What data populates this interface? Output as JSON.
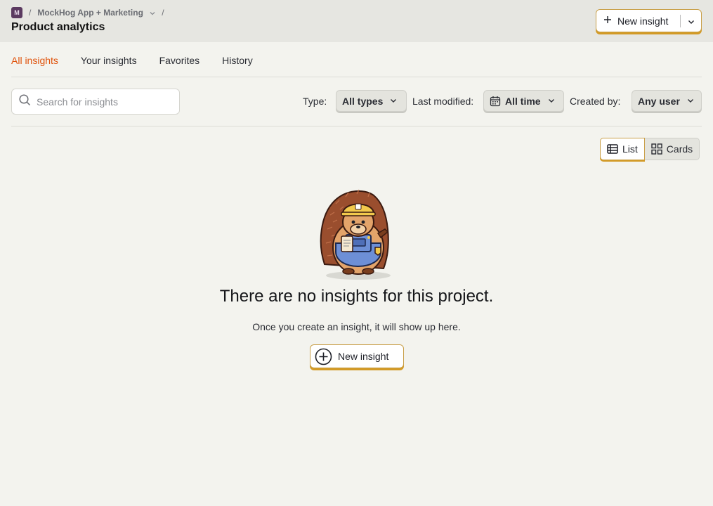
{
  "breadcrumb": {
    "project_badge": "M",
    "project_name": "MockHog App + Marketing",
    "separator": "/"
  },
  "page_title": "Product analytics",
  "header_button": {
    "label": "New insight"
  },
  "tabs": [
    {
      "label": "All insights",
      "active": true
    },
    {
      "label": "Your insights",
      "active": false
    },
    {
      "label": "Favorites",
      "active": false
    },
    {
      "label": "History",
      "active": false
    }
  ],
  "search": {
    "placeholder": "Search for insights",
    "value": ""
  },
  "filters": {
    "type": {
      "label": "Type:",
      "value": "All types"
    },
    "last_modified": {
      "label": "Last modified:",
      "value": "All time"
    },
    "created_by": {
      "label": "Created by:",
      "value": "Any user"
    }
  },
  "view_toggle": {
    "list_label": "List",
    "cards_label": "Cards",
    "selected": "List"
  },
  "empty_state": {
    "title": "There are no insights for this project.",
    "subtitle": "Once you create an insight, it will show up here.",
    "button_label": "New insight"
  },
  "colors": {
    "accent": "#e0530c",
    "button_border": "#d39a26",
    "background": "#f3f3ee"
  }
}
